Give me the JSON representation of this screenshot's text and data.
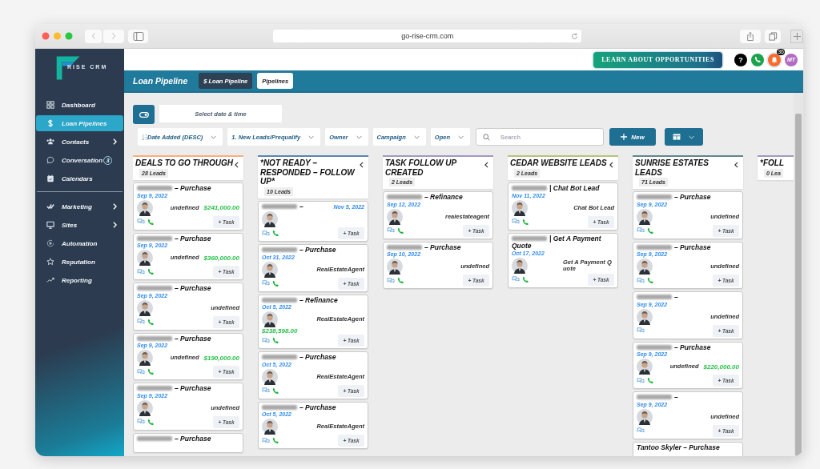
{
  "browser": {
    "url": "go-rise-crm.com"
  },
  "sidebar": {
    "logo_text": "RISE CRM",
    "primary_items": [
      {
        "label": "Dashboard",
        "selected": false,
        "submenu": false
      },
      {
        "label": "Loan Pipelines",
        "selected": true,
        "submenu": false
      },
      {
        "label": "Contacts",
        "selected": false,
        "submenu": true
      },
      {
        "label": "Conversation",
        "selected": false,
        "submenu": false,
        "badge": "3"
      },
      {
        "label": "Calendars",
        "selected": false,
        "submenu": false
      }
    ],
    "secondary_items": [
      {
        "label": "Marketing",
        "selected": false,
        "submenu": true
      },
      {
        "label": "Sites",
        "selected": false,
        "submenu": true
      },
      {
        "label": "Automation",
        "selected": false,
        "submenu": false
      },
      {
        "label": "Reputation",
        "selected": false,
        "submenu": false
      },
      {
        "label": "Reporting",
        "selected": false,
        "submenu": false
      }
    ]
  },
  "topbar": {
    "cta": "LEARN ABOUT OPPORTUNITIES",
    "help": "?",
    "notification_count": "36",
    "avatar_initials": "MT"
  },
  "header": {
    "title": "Loan Pipeline",
    "tabs": [
      {
        "label": "$ Loan Pipeline",
        "selected": true
      },
      {
        "label": "Pipelines",
        "selected": false
      }
    ]
  },
  "filters": {
    "date_field": {
      "placeholder": "Select date & time"
    },
    "dropdowns": [
      {
        "label": "Date Added (DESC)",
        "kind": "sort"
      },
      {
        "label": "1. New Leads/Prequalify",
        "kind": "plain"
      },
      {
        "label": "Owner",
        "kind": "plain"
      },
      {
        "label": "Campaign",
        "kind": "plain"
      },
      {
        "label": "Open",
        "kind": "plain"
      }
    ],
    "search": {
      "placeholder": "Search"
    },
    "new_button": "New"
  },
  "columns": [
    {
      "title": "DEALS TO GO THROUGH",
      "count": "28 Leads",
      "color": "#f5b07a",
      "cards": [
        {
          "kind": "standard",
          "name_hidden": true,
          "title": "– Purchase",
          "date": "Sep 9, 2022",
          "source": "undefined",
          "amount": "$241,000.00",
          "phone": true,
          "task": "+ Task"
        },
        {
          "kind": "standard",
          "name_hidden": true,
          "title": "– Purchase",
          "date": "Sep 9, 2022",
          "source": "undefined",
          "amount": "$360,000.00",
          "phone": true,
          "task": "+ Task"
        },
        {
          "kind": "standard",
          "name_hidden": true,
          "title": "– Purchase",
          "date": "Sep 9, 2022",
          "source": "undefined",
          "phone": true,
          "task": "+ Task"
        },
        {
          "kind": "standard",
          "name_hidden": true,
          "title": "– Purchase",
          "date": "Sep 9, 2022",
          "source": "undefined",
          "amount": "$190,000.00",
          "phone": true,
          "task": "+ Task"
        },
        {
          "kind": "standard",
          "name_hidden": true,
          "title": "– Purchase",
          "date": "Sep 9, 2022",
          "source": "undefined",
          "phone": true,
          "task": "+ Task"
        },
        {
          "kind": "partial",
          "name_hidden": true,
          "title": "– Purchase"
        }
      ]
    },
    {
      "title": "*NOT READY – RESPONDED – FOLLOW UP*",
      "count": "10 Leads",
      "color": "#5b86ad",
      "cards": [
        {
          "kind": "inline-date",
          "name_hidden": true,
          "title": "–",
          "date": "Nov 5, 2022",
          "phone": true,
          "task": "+ Task"
        },
        {
          "kind": "standard",
          "name_hidden": true,
          "title": "– Purchase",
          "date": "Oct 31, 2022",
          "source": "RealEstateAgent",
          "phone": true,
          "task": "+ Task"
        },
        {
          "kind": "stacked",
          "name_hidden": true,
          "title": "– Refinance",
          "date": "Oct 5, 2022",
          "source": "RealEstateAgent",
          "amount": "$238,598.00",
          "phone": true,
          "task": "+ Task"
        },
        {
          "kind": "standard",
          "name_hidden": true,
          "title": "– Purchase",
          "date": "Oct 5, 2022",
          "source": "RealEstateAgent",
          "phone": true,
          "task": "+ Task"
        },
        {
          "kind": "standard",
          "name_hidden": true,
          "title": "– Purchase",
          "date": "Oct 5, 2022",
          "source": "RealEstateAgent",
          "phone": true,
          "task": "+ Task"
        }
      ]
    },
    {
      "title": "TASK FOLLOW UP CREATED",
      "count": "2 Leads",
      "color": "#a597c4",
      "cards": [
        {
          "kind": "standard",
          "name_hidden": true,
          "title": "– Refinance",
          "date": "Sep 12, 2022",
          "source": "realestateagent",
          "phone": true,
          "task": "+ Task"
        },
        {
          "kind": "standard",
          "name_hidden": true,
          "title": "– Purchase",
          "date": "Sep 10, 2022",
          "source": "undefined",
          "phone": true,
          "task": "+ Task"
        }
      ]
    },
    {
      "title": "CEDAR WEBSITE LEADS",
      "count": "2 Leads",
      "color": "#b6c37c",
      "cards": [
        {
          "kind": "standard",
          "name_hidden": true,
          "title": "| Chat Bot Lead",
          "date": "Nov 11, 2022",
          "source": "Chat Bot Lead",
          "phone": true,
          "task": "+ Task"
        },
        {
          "kind": "standard",
          "name_hidden": true,
          "title": "| Get A Payment Quote",
          "date": "Oct 17, 2022",
          "source": "Get A Payment Quote",
          "phone": true,
          "task": "+ Task"
        }
      ]
    },
    {
      "title": "SUNRISE ESTATES LEADS",
      "count": "71 Leads",
      "color": "#5e878c",
      "cards": [
        {
          "kind": "standard",
          "name_hidden": true,
          "title": "– Purchase",
          "date": "Sep 9, 2022",
          "source": "undefined",
          "phone": true,
          "task": "+ Task"
        },
        {
          "kind": "standard",
          "name_hidden": true,
          "title": "– Purchase",
          "date": "Sep 9, 2022",
          "source": "undefined",
          "phone": true,
          "task": "+ Task"
        },
        {
          "kind": "standard",
          "name_hidden": true,
          "title": "–",
          "date": "Sep 9, 2022",
          "source": "undefined",
          "phone": false,
          "task": "+ Task"
        },
        {
          "kind": "standard",
          "name_hidden": true,
          "title": "– Purchase",
          "date": "Sep 9, 2022",
          "source": "undefined",
          "amount": "$220,000.00",
          "phone": true,
          "task": "+ Task"
        },
        {
          "kind": "standard",
          "name_hidden": true,
          "title": "–",
          "date": "Sep 9, 2022",
          "source": "undefined",
          "phone": false,
          "task": "+ Task"
        },
        {
          "kind": "partial",
          "name_hidden": false,
          "title": "Tantoo Skyler – Purchase"
        }
      ]
    },
    {
      "title": "*FOLL",
      "count": "0 Lea",
      "color": "#a597c4"
    }
  ]
}
